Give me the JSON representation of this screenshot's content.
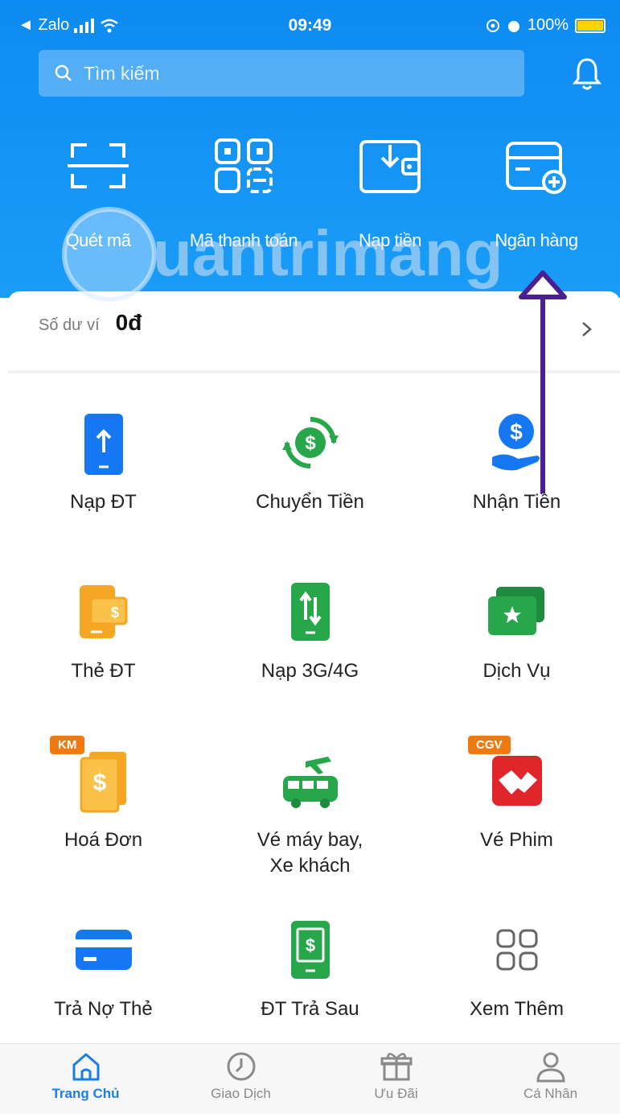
{
  "status_bar": {
    "back_app": "◄ Zalo",
    "time": "09:49",
    "battery": "100%"
  },
  "search": {
    "placeholder": "Tìm kiếm"
  },
  "quick_actions": [
    {
      "label": "Quét mã",
      "icon": "scan-icon"
    },
    {
      "label": "Mã thanh toán",
      "icon": "qr-pay-icon"
    },
    {
      "label": "Nạp tiền",
      "icon": "wallet-topup-icon"
    },
    {
      "label": "Ngân hàng",
      "icon": "bank-card-add-icon"
    }
  ],
  "wallet": {
    "label": "Số dư ví",
    "value": "0đ"
  },
  "services": [
    {
      "label": "Nạp ĐT",
      "icon": "phone-topup-icon"
    },
    {
      "label": "Chuyển Tiền",
      "icon": "money-transfer-icon"
    },
    {
      "label": "Nhận Tiền",
      "icon": "receive-money-icon"
    },
    {
      "label": "Thẻ ĐT",
      "icon": "phone-card-icon"
    },
    {
      "label": "Nạp 3G/4G",
      "icon": "data-topup-icon"
    },
    {
      "label": "Dịch Vụ",
      "icon": "services-icon"
    },
    {
      "label": "Hoá Đơn",
      "icon": "bill-icon",
      "badge": "KM"
    },
    {
      "label": "Vé máy bay,",
      "label2": "Xe khách",
      "icon": "bus-plane-icon"
    },
    {
      "label": "Vé Phim",
      "icon": "movie-ticket-icon",
      "badge": "CGV"
    },
    {
      "label": "Trả Nợ Thẻ",
      "icon": "credit-card-icon"
    },
    {
      "label": "ĐT Trả Sau",
      "icon": "postpaid-phone-icon"
    },
    {
      "label": "Xem Thêm",
      "icon": "more-grid-icon"
    }
  ],
  "tabs": [
    {
      "label": "Trang Chủ",
      "icon": "home-icon",
      "active": true
    },
    {
      "label": "Giao Dịch",
      "icon": "clock-icon"
    },
    {
      "label": "Ưu Đãi",
      "icon": "gift-icon"
    },
    {
      "label": "Cá Nhân",
      "icon": "person-icon"
    }
  ],
  "watermark": "Quantrimang",
  "colors": {
    "primary": "#1a9cf8",
    "active_tab": "#1b7ee6",
    "arrow": "#4b1f8f"
  }
}
